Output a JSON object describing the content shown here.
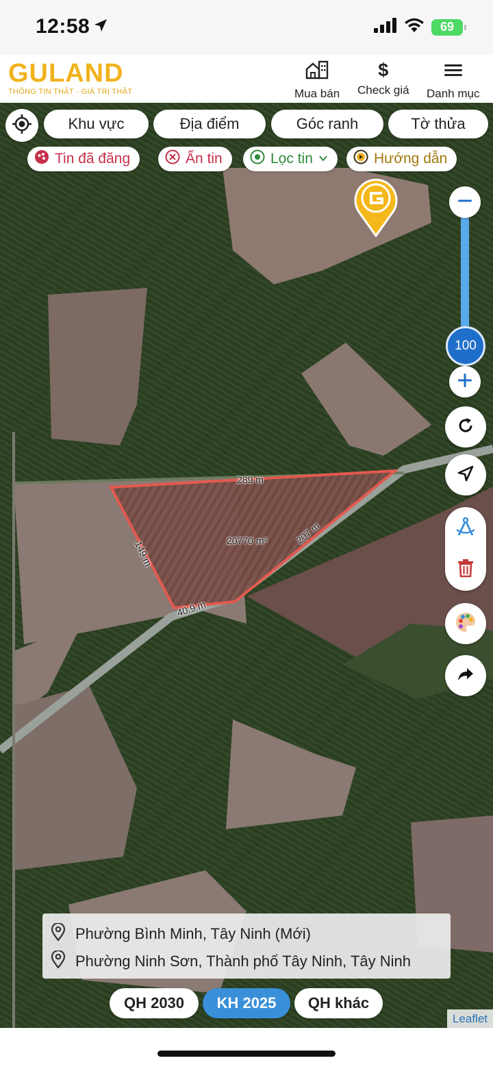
{
  "status_bar": {
    "time": "12:58",
    "battery": "69",
    "icons": [
      "location-arrow-icon",
      "signal-icon",
      "wifi-icon",
      "battery-charging-icon"
    ]
  },
  "header": {
    "logo_text": "GULAND",
    "tagline": "THÔNG TIN THẬT - GIÁ TRỊ THẬT",
    "nav": {
      "buy_label": "Mua bán",
      "price_label": "Check giá",
      "price_symbol": "$",
      "menu_label": "Danh mục"
    }
  },
  "filters": {
    "area": "Khu vực",
    "place": "Địa điểm",
    "corner": "Góc ranh",
    "parcel": "Tờ thửa"
  },
  "chips": {
    "posted": "Tin đã đăng",
    "hide": "Ẩn tin",
    "filter": "Lọc tin",
    "guide": "Hướng dẫn"
  },
  "zoom": {
    "level": "100",
    "level_fraction": 1.0
  },
  "measurement": {
    "area": "20770 m²",
    "edge_top": "289 m",
    "edge_right": "207 m",
    "edge_left": "149 m",
    "edge_bottom": "40.9 m"
  },
  "address": {
    "line1": "Phường Bình Minh, Tây Ninh (Mới)",
    "line2": "Phường Ninh Sơn, Thành phố Tây Ninh, Tây Ninh"
  },
  "plan_tabs": {
    "qh2030": "QH 2030",
    "kh2025": "KH 2025",
    "other": "QH khác",
    "active": "KH 2025"
  },
  "attribution": "Leaflet",
  "colors": {
    "brand_gold": "#f0b21c",
    "accent_blue": "#3a8fd9",
    "parcel_outline": "#e25a4f",
    "chip_red": "#c5304a",
    "chip_green": "#2e8a3a"
  }
}
